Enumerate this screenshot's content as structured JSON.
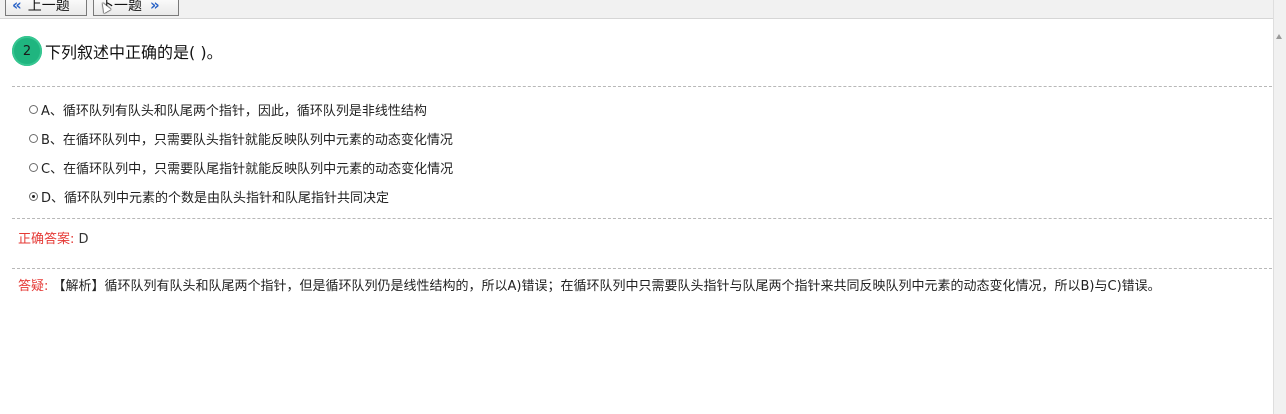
{
  "nav": {
    "prev_icon": "«",
    "prev_label": "上一题",
    "next_label": "下一题",
    "next_icon": "»"
  },
  "question": {
    "number": "2",
    "title": "下列叙述中正确的是(  )。"
  },
  "options": [
    {
      "label": "A、循环队列有队头和队尾两个指针，因此，循环队列是非线性结构",
      "selected": false
    },
    {
      "label": "B、在循环队列中，只需要队头指针就能反映队列中元素的动态变化情况",
      "selected": false
    },
    {
      "label": "C、在循环队列中，只需要队尾指针就能反映队列中元素的动态变化情况",
      "selected": false
    },
    {
      "label": "D、循环队列中元素的个数是由队头指针和队尾指针共同决定",
      "selected": true
    }
  ],
  "answer": {
    "label": "正确答案:",
    "value": "D"
  },
  "analysis": {
    "label": "答疑:",
    "text": "【解析】循环队列有队头和队尾两个指针，但是循环队列仍是线性结构的，所以A)错误；在循环队列中只需要队头指针与队尾两个指针来共同反映队列中元素的动态变化情况，所以B)与C)错误。"
  },
  "colors": {
    "badge": "#1fb57f",
    "label_red": "#e53935",
    "chevron_blue": "#2a63c7"
  }
}
